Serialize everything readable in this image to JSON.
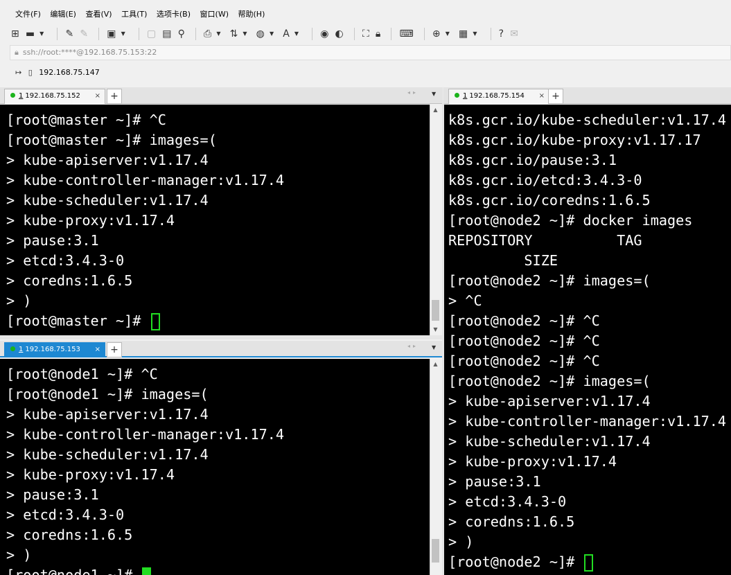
{
  "menu": [
    "文件(F)",
    "编辑(E)",
    "查看(V)",
    "工具(T)",
    "选项卡(B)",
    "窗口(W)",
    "帮助(H)"
  ],
  "address": "ssh://root:****@192.168.75.153:22",
  "quickbar": {
    "item": "192.168.75.147"
  },
  "panes": {
    "top_left": {
      "tab": {
        "number": "1",
        "title": "192.168.75.152",
        "close": "×"
      },
      "add": "+",
      "lines": [
        "[root@master ~]# ^C",
        "[root@master ~]# images=(",
        "> kube-apiserver:v1.17.4",
        "> kube-controller-manager:v1.17.4",
        "> kube-scheduler:v1.17.4",
        "> kube-proxy:v1.17.4",
        "> pause:3.1",
        "> etcd:3.4.3-0",
        "> coredns:1.6.5",
        "> )",
        "[root@master ~]# "
      ]
    },
    "bottom_left": {
      "tab": {
        "number": "1",
        "title": "192.168.75.153",
        "close": "×"
      },
      "add": "+",
      "lines": [
        "[root@node1 ~]# ^C",
        "[root@node1 ~]# images=(",
        "> kube-apiserver:v1.17.4",
        "> kube-controller-manager:v1.17.4",
        "> kube-scheduler:v1.17.4",
        "> kube-proxy:v1.17.4",
        "> pause:3.1",
        "> etcd:3.4.3-0",
        "> coredns:1.6.5",
        "> )",
        "[root@node1 ~]# "
      ]
    },
    "right": {
      "tab": {
        "number": "1",
        "title": "192.168.75.154",
        "close": "×"
      },
      "add": "+",
      "lines": [
        "k8s.gcr.io/kube-scheduler:v1.17.4",
        "k8s.gcr.io/kube-proxy:v1.17.17",
        "k8s.gcr.io/pause:3.1",
        "k8s.gcr.io/etcd:3.4.3-0",
        "k8s.gcr.io/coredns:1.6.5",
        "[root@node2 ~]# docker images",
        "REPOSITORY          TAG",
        "         SIZE",
        "[root@node2 ~]# images=(",
        "> ^C",
        "[root@node2 ~]# ^C",
        "[root@node2 ~]# ^C",
        "[root@node2 ~]# ^C",
        "[root@node2 ~]# images=(",
        "> kube-apiserver:v1.17.4",
        "> kube-controller-manager:v1.17.4",
        "> kube-scheduler:v1.17.4",
        "> kube-proxy:v1.17.4",
        "> pause:3.1",
        "> etcd:3.4.3-0",
        "> coredns:1.6.5",
        "> )",
        "[root@node2 ~]# "
      ]
    }
  },
  "colors": {
    "terminal_bg": "#000000",
    "terminal_fg": "#ffffff",
    "cursor": "#22dd22",
    "active_tab": "#1e88d2",
    "connected_dot": "#1bb31b"
  }
}
